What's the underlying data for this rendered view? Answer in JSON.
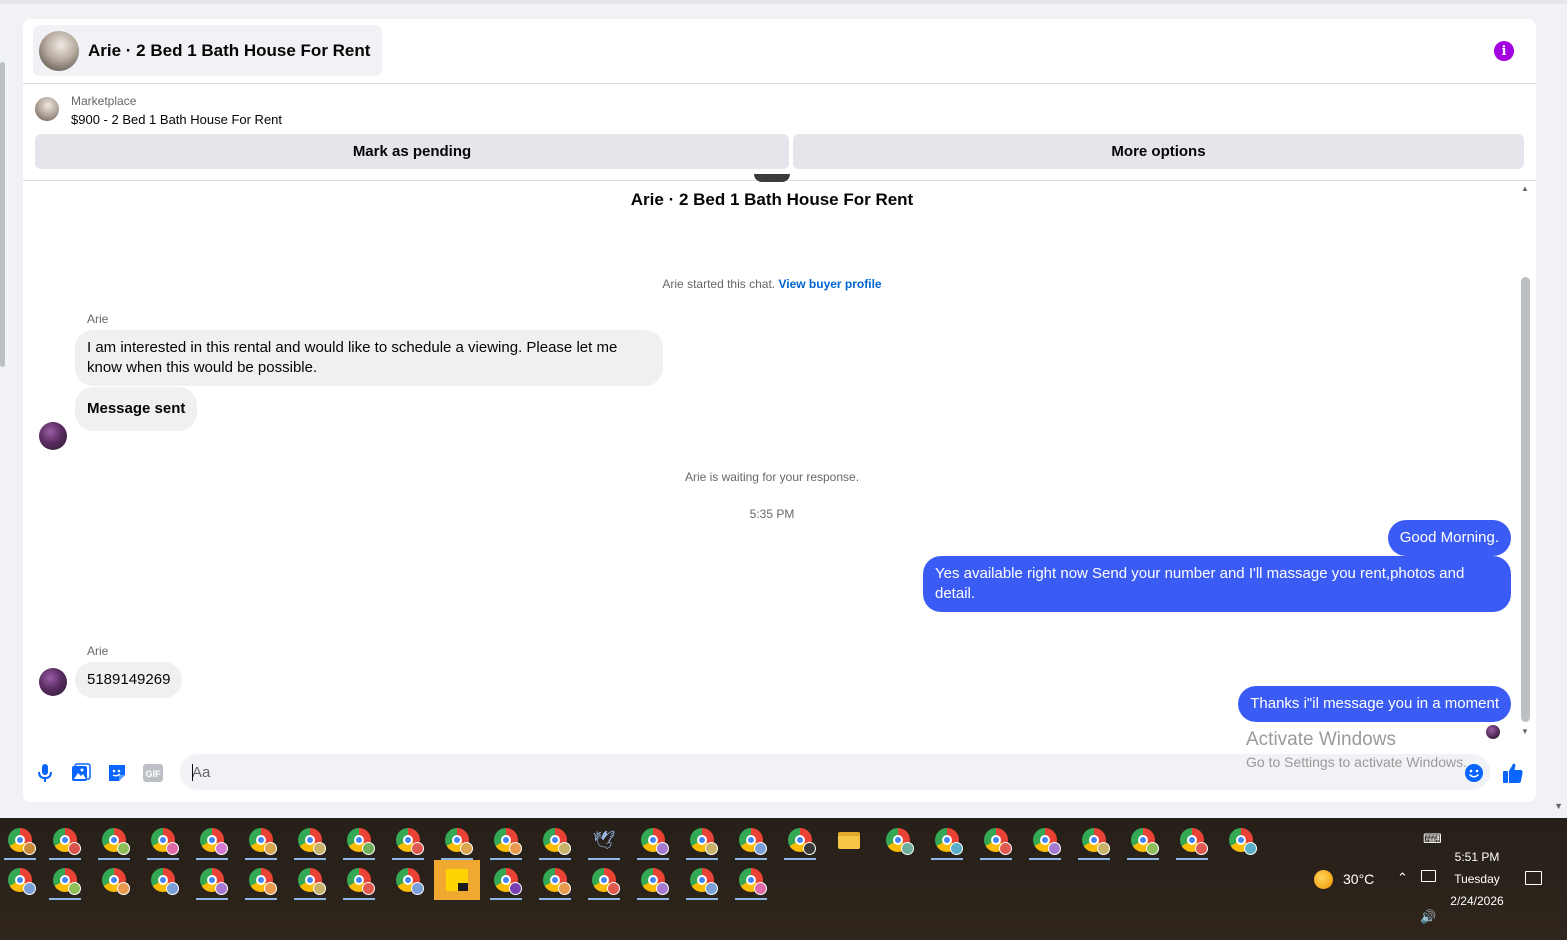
{
  "header": {
    "title": "Arie · 2 Bed 1 Bath House For Rent",
    "info_icon": "info-icon",
    "accent_color": "#a400e1"
  },
  "listing": {
    "category": "Marketplace",
    "name": "$900 - 2 Bed 1 Bath House For Rent",
    "buttons": {
      "mark_pending": "Mark as pending",
      "more_options": "More options"
    }
  },
  "conversation": {
    "title": "Arie · 2 Bed 1 Bath House For Rent",
    "started_text": "Arie started this chat.",
    "started_link": "View buyer profile",
    "waiting_text": "Arie is waiting for your response.",
    "timestamp": "5:35 PM",
    "messages": [
      {
        "sender": "Arie",
        "direction": "in",
        "text": "I am interested in this rental and would like to schedule a viewing. Please let me know when this would be possible."
      },
      {
        "direction": "in",
        "text": "Message sent"
      },
      {
        "direction": "out",
        "text": "Good Morning."
      },
      {
        "direction": "out",
        "text": "Yes available right now Send your number and I'll massage you rent,photos and detail."
      },
      {
        "sender": "Arie",
        "direction": "in",
        "text": "5189149269"
      },
      {
        "direction": "out",
        "text": "Thanks i\"il message you in a moment"
      }
    ],
    "outgoing_color": "#3b5bf5",
    "incoming_color": "#f0f0f0"
  },
  "composer": {
    "placeholder": "Aa",
    "icons": [
      "microphone-icon",
      "photo-icon",
      "sticker-icon",
      "gif-icon",
      "emoji-icon",
      "thumbs-up-icon"
    ],
    "gif_label": "GIF"
  },
  "watermark": {
    "line1": "Activate Windows",
    "line2": "Go to Settings to activate Windows."
  },
  "taskbar": {
    "weather_temp": "30°C",
    "time": "5:51 PM",
    "day": "Tuesday",
    "date": "2/24/2026"
  }
}
